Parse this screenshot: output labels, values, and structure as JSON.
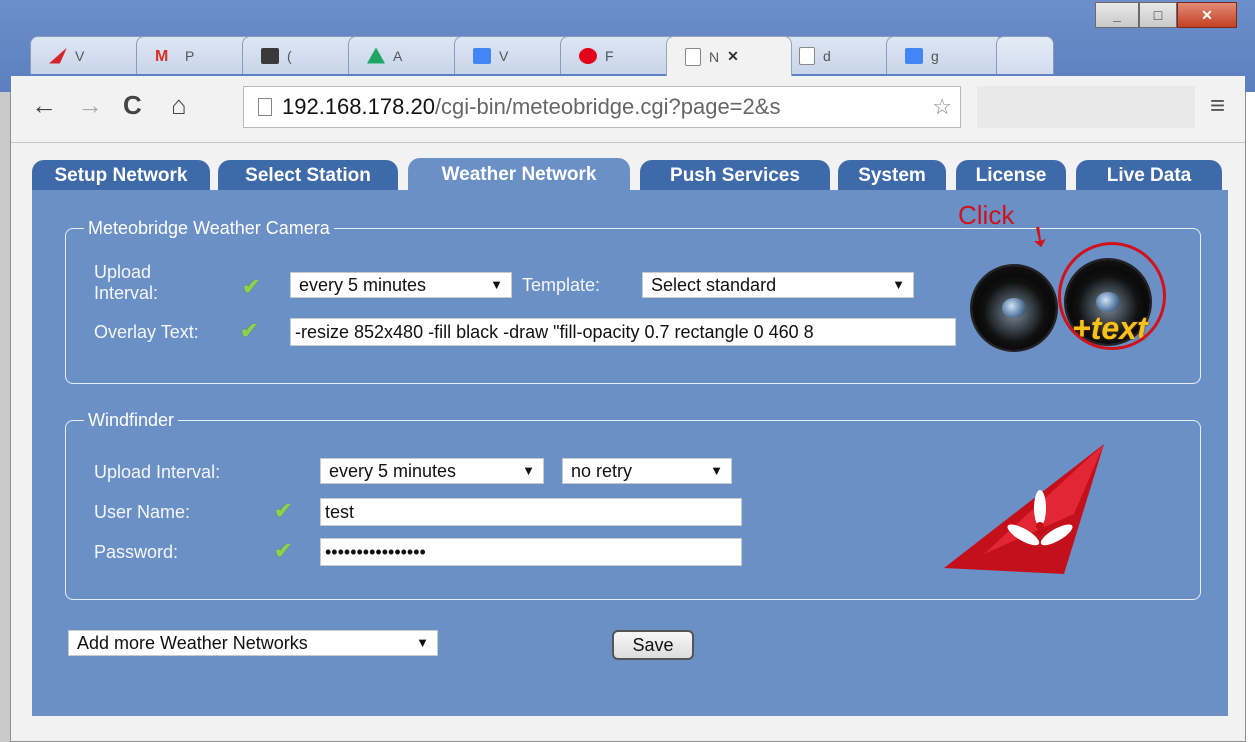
{
  "browser": {
    "tabs": [
      {
        "title": "V",
        "favicon": "warning-app-icon",
        "color": "#d8232a"
      },
      {
        "title": "P",
        "favicon": "gmail-icon",
        "color": "#d93025"
      },
      {
        "title": "(",
        "favicon": "trello-icon",
        "color": "#3a3a3a"
      },
      {
        "title": "A",
        "favicon": "drive-icon",
        "color": "#1fa463"
      },
      {
        "title": "V",
        "favicon": "docs-icon",
        "color": "#4285f4"
      },
      {
        "title": "F",
        "favicon": "fritzbox-icon",
        "color": "#e2001a"
      },
      {
        "title": "N",
        "favicon": "page-icon",
        "color": "#888888",
        "active": true
      },
      {
        "title": "d",
        "favicon": "page-icon",
        "color": "#888888"
      },
      {
        "title": "g",
        "favicon": "google-icon",
        "color": "#4285f4"
      }
    ],
    "url": "192.168.178.20/cgi-bin/meteobridge.cgi?page=2&s",
    "url_host": "192.168.178.20",
    "url_path": "/cgi-bin/meteobridge.cgi?page=2&s"
  },
  "nav_tabs": [
    {
      "label": "Setup Network"
    },
    {
      "label": "Select Station"
    },
    {
      "label": "Weather Network",
      "active": true
    },
    {
      "label": "Push Services"
    },
    {
      "label": "System"
    },
    {
      "label": "License"
    },
    {
      "label": "Live Data"
    }
  ],
  "camera": {
    "legend": "Meteobridge Weather Camera",
    "upload_interval_label": "Upload Interval:",
    "upload_interval_value": "every 5 minutes",
    "template_label": "Template:",
    "template_value": "Select standard",
    "overlay_label": "Overlay Text:",
    "overlay_value": "-resize 852x480 -fill black -draw \"fill-opacity 0.7 rectangle 0 460 8",
    "text_badge": "+text",
    "annotation": "Click"
  },
  "windfinder": {
    "legend": "Windfinder",
    "upload_interval_label": "Upload Interval:",
    "upload_interval_value": "every 5 minutes",
    "retry_value": "no retry",
    "username_label": "User Name:",
    "username_value": "test",
    "password_label": "Password:",
    "password_value": "••••••••••••••••"
  },
  "footer": {
    "add_more_value": "Add more Weather Networks",
    "save_label": "Save"
  },
  "colors": {
    "page_bg": "#6b90c6",
    "tab_bg": "#3f6aaa",
    "check": "#8fd14f",
    "annotation": "#d0121b"
  }
}
